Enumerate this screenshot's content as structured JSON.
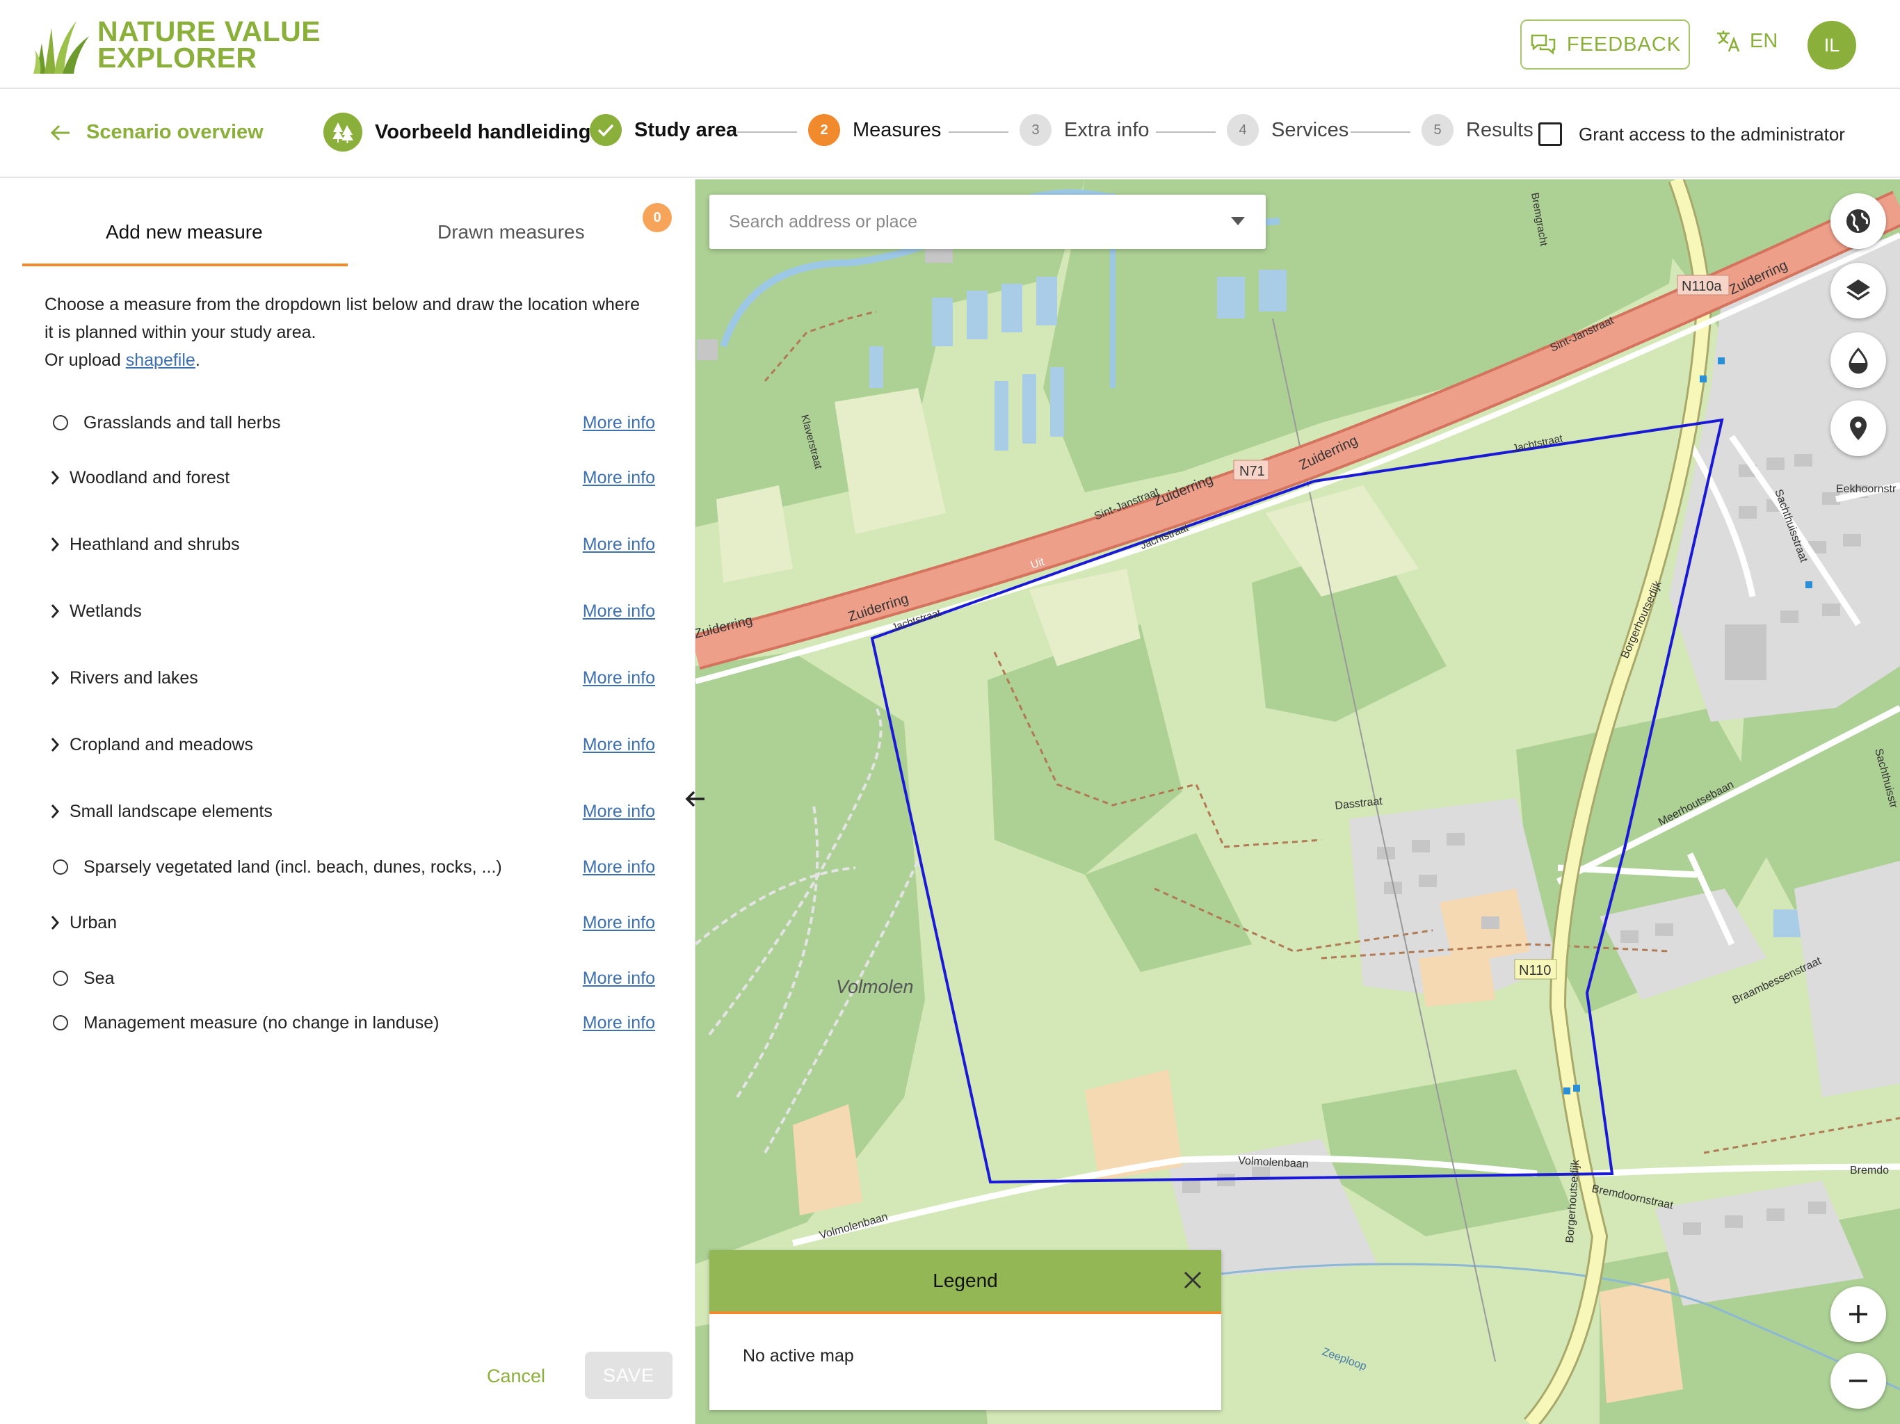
{
  "app": {
    "logo_line1": "NATURE VALUE",
    "logo_line2": "EXPLORER",
    "feedback_label": "FEEDBACK",
    "language": "EN",
    "user_initials": "IL",
    "accent_color": "#8aaf3a",
    "highlight_color": "#f08a2c"
  },
  "stepbar": {
    "back_label": "Scenario overview",
    "project_name": "Voorbeeld handleiding",
    "steps": [
      {
        "number": "",
        "label": "Study area",
        "state": "done"
      },
      {
        "number": "2",
        "label": "Measures",
        "state": "active"
      },
      {
        "number": "3",
        "label": "Extra info",
        "state": "todo"
      },
      {
        "number": "4",
        "label": "Services",
        "state": "todo"
      },
      {
        "number": "5",
        "label": "Results",
        "state": "todo"
      }
    ],
    "grant_label": "Grant access to the administrator",
    "grant_checked": false
  },
  "panel": {
    "tabs": [
      {
        "label": "Add new measure",
        "active": true
      },
      {
        "label": "Drawn measures",
        "active": false
      }
    ],
    "drawn_count": "0",
    "intro": "Choose a measure from the dropdown list below and draw the location where it is planned within your study area.",
    "upload_prefix": "Or upload ",
    "upload_link": "shapefile",
    "upload_suffix": ".",
    "more_info_label": "More info",
    "measures": [
      {
        "label": "Grasslands and tall herbs",
        "kind": "radio"
      },
      {
        "label": "Woodland and forest",
        "kind": "group"
      },
      {
        "label": "Heathland and shrubs",
        "kind": "group"
      },
      {
        "label": "Wetlands",
        "kind": "group"
      },
      {
        "label": "Rivers and lakes",
        "kind": "group"
      },
      {
        "label": "Cropland and meadows",
        "kind": "group"
      },
      {
        "label": "Small landscape elements",
        "kind": "group"
      },
      {
        "label": "Sparsely vegetated land (incl. beach, dunes, rocks, ...)",
        "kind": "radio"
      },
      {
        "label": "Urban",
        "kind": "group"
      },
      {
        "label": "Sea",
        "kind": "radio"
      },
      {
        "label": "Management measure (no change in landuse)",
        "kind": "radio"
      }
    ],
    "cancel_label": "Cancel",
    "save_label": "SAVE"
  },
  "map": {
    "search_placeholder": "Search address or place",
    "legend_title": "Legend",
    "legend_empty": "No active map",
    "buttons": [
      "globe-icon",
      "layers-icon",
      "drop-icon",
      "location-pin-icon",
      "zoom-in-icon",
      "zoom-out-icon"
    ],
    "labels": {
      "zuiderring_1": "Zuiderring",
      "zuiderring_2": "Zuiderring",
      "zuiderring_3": "Zuiderring",
      "zuiderring_4": "Zuiderring",
      "n71": "N71",
      "n110a": "N110a",
      "n110": "N110",
      "sint_janstraat_1": "Sint-Janstraat",
      "sint_janstraat_2": "Sint-Janstraat",
      "jachtstraat_1": "Jachtstraat",
      "jachtstraat_2": "Jachtstraat",
      "jachtstraat_3": "Jachtstraat",
      "klaverstraat": "Klaverstraat",
      "volmolen": "Volmolen",
      "volmolenbaan_1": "Volmolenbaan",
      "volmolenbaan_2": "Volmolenbaan",
      "dasstraat": "Dasstraat",
      "meerhoutsebaan": "Meerhoutsebaan",
      "braambessenstraat": "Braambessenstraat",
      "bremdoornstraat": "Bremdoornstraat",
      "bremdo": "Bremdo",
      "borgerhoutsedijk_1": "Borgerhoutsedijk",
      "borgerhoutsedijk_2": "Borgerhoutsedijk",
      "sachthuisstraat_1": "Sachthuisstraat",
      "sachthuisstraat_2": "Sachthuisstr",
      "eekhoornstr": "Eekhoornstr",
      "zeeploop": "Zeeploop",
      "uit": "Uit",
      "bremgracht": "Bremgracht"
    }
  }
}
